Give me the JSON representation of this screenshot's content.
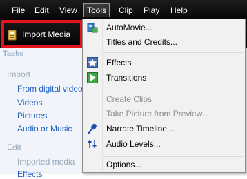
{
  "menubar": {
    "items": [
      "File",
      "Edit",
      "View",
      "Tools",
      "Clip",
      "Play",
      "Help"
    ],
    "active": "Tools"
  },
  "toolbar": {
    "import_label": "Import Media"
  },
  "taskpane": {
    "heading": "Tasks",
    "sections": [
      {
        "title": "Import",
        "links": [
          "From digital video",
          "Videos",
          "Pictures",
          "Audio or Music"
        ]
      },
      {
        "title": "Edit",
        "links": [
          "Imported media",
          "Effects"
        ]
      }
    ]
  },
  "tools_menu": {
    "items": [
      {
        "label": "AutoMovie...",
        "icon": "automovie-icon",
        "enabled": true
      },
      {
        "label": "Titles and Credits...",
        "icon": "",
        "enabled": true
      },
      {
        "label": "Effects",
        "icon": "effects-star-icon",
        "enabled": true
      },
      {
        "label": "Transitions",
        "icon": "transitions-icon",
        "enabled": true
      },
      {
        "label": "Create Clips",
        "icon": "",
        "enabled": false
      },
      {
        "label": "Take Picture from Preview...",
        "icon": "",
        "enabled": false
      },
      {
        "label": "Narrate Timeline...",
        "icon": "microphone-icon",
        "enabled": true
      },
      {
        "label": "Audio Levels...",
        "icon": "audio-levels-icon",
        "enabled": true
      },
      {
        "label": "Options...",
        "icon": "",
        "enabled": true
      }
    ]
  },
  "colors": {
    "highlight_border": "#e3141c",
    "link": "#1f5fbf",
    "menubar_bg": "#0a0a0a"
  }
}
